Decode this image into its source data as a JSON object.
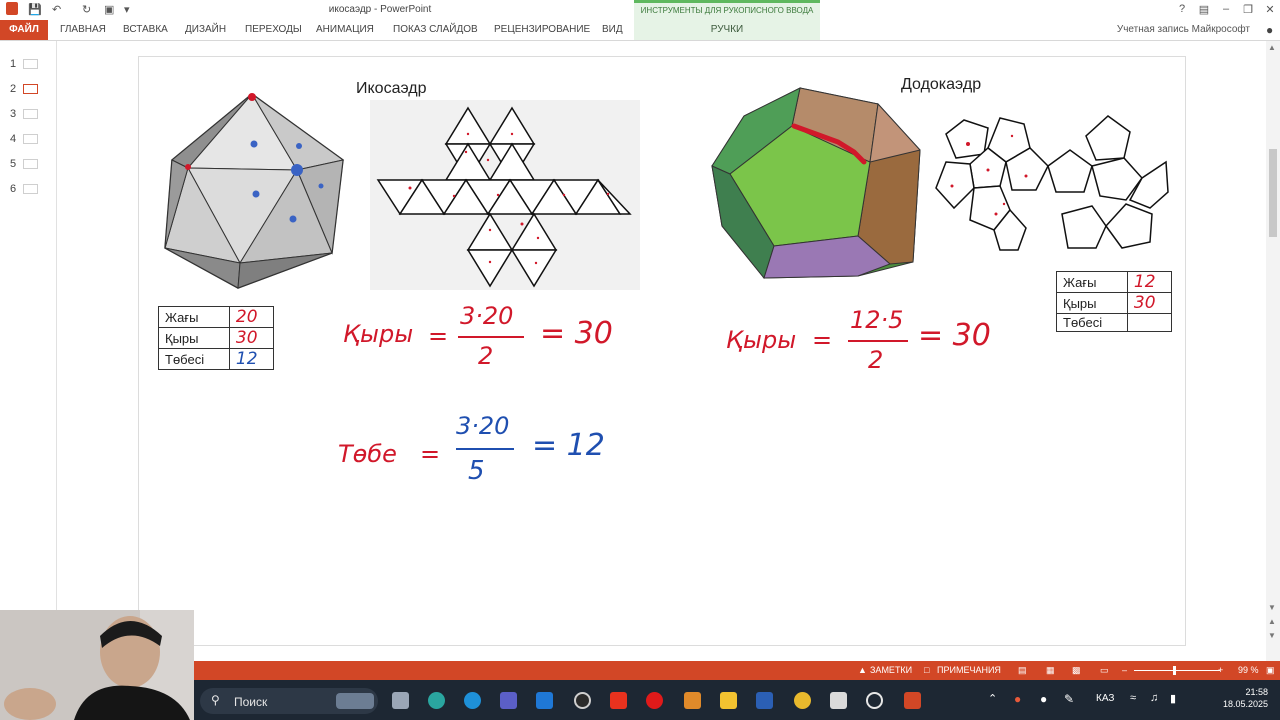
{
  "window": {
    "document_title": "икосаэдр - PowerPoint",
    "contextual_tab_group": "ИНСТРУМЕНТЫ ДЛЯ РУКОПИСНОГО ВВОДА",
    "account": "Учетная запись Майкрософт"
  },
  "ribbon": {
    "tabs": [
      "ФАЙЛ",
      "ГЛАВНАЯ",
      "ВСТАВКА",
      "ДИЗАЙН",
      "ПЕРЕХОДЫ",
      "АНИМАЦИЯ",
      "ПОКАЗ СЛАЙДОВ",
      "РЕЦЕНЗИРОВАНИЕ",
      "ВИД"
    ],
    "contextual_tab": "РУЧКИ"
  },
  "thumbnails": [
    "1",
    "2",
    "3",
    "4",
    "5",
    "6"
  ],
  "selected_slide": 2,
  "slide": {
    "icosahedron_title": "Икосаэдр",
    "dodecahedron_title": "Додокаэдр",
    "ico_table": [
      {
        "label": "Жағы",
        "value": "20"
      },
      {
        "label": "Қыры",
        "value": "30"
      },
      {
        "label": "Төбесі",
        "value": "12"
      }
    ],
    "dodeca_table": [
      {
        "label": "Жағы",
        "value": "12"
      },
      {
        "label": "Қыры",
        "value": "30"
      },
      {
        "label": "Төбесі",
        "value": ""
      }
    ],
    "ink": {
      "edges_ico_word": "Қыры",
      "ico_edges_numerator": "3·20",
      "ico_edges_denominator": "2",
      "ico_edges_result": "= 30",
      "vertices_word": "Төбе",
      "ico_vertices_numerator": "3·20",
      "ico_vertices_denominator": "5",
      "ico_vertices_result": "= 12",
      "edges_dodeca_word": "Қыры",
      "dodeca_edges_numerator": "12·5",
      "dodeca_edges_denominator": "2",
      "dodeca_edges_result": "= 30"
    }
  },
  "statusbar": {
    "notes": "ЗАМЕТКИ",
    "comments": "ПРИМЕЧАНИЯ",
    "zoom": "99 %"
  },
  "taskbar": {
    "search": "Поиск",
    "language": "КАЗ",
    "time": "21:58",
    "date": "18.05.2025"
  },
  "colors": {
    "accent": "#d24726",
    "ink_red": "#d1182a",
    "ink_blue": "#1f4fb0",
    "contextual": "#e6f3e6"
  }
}
